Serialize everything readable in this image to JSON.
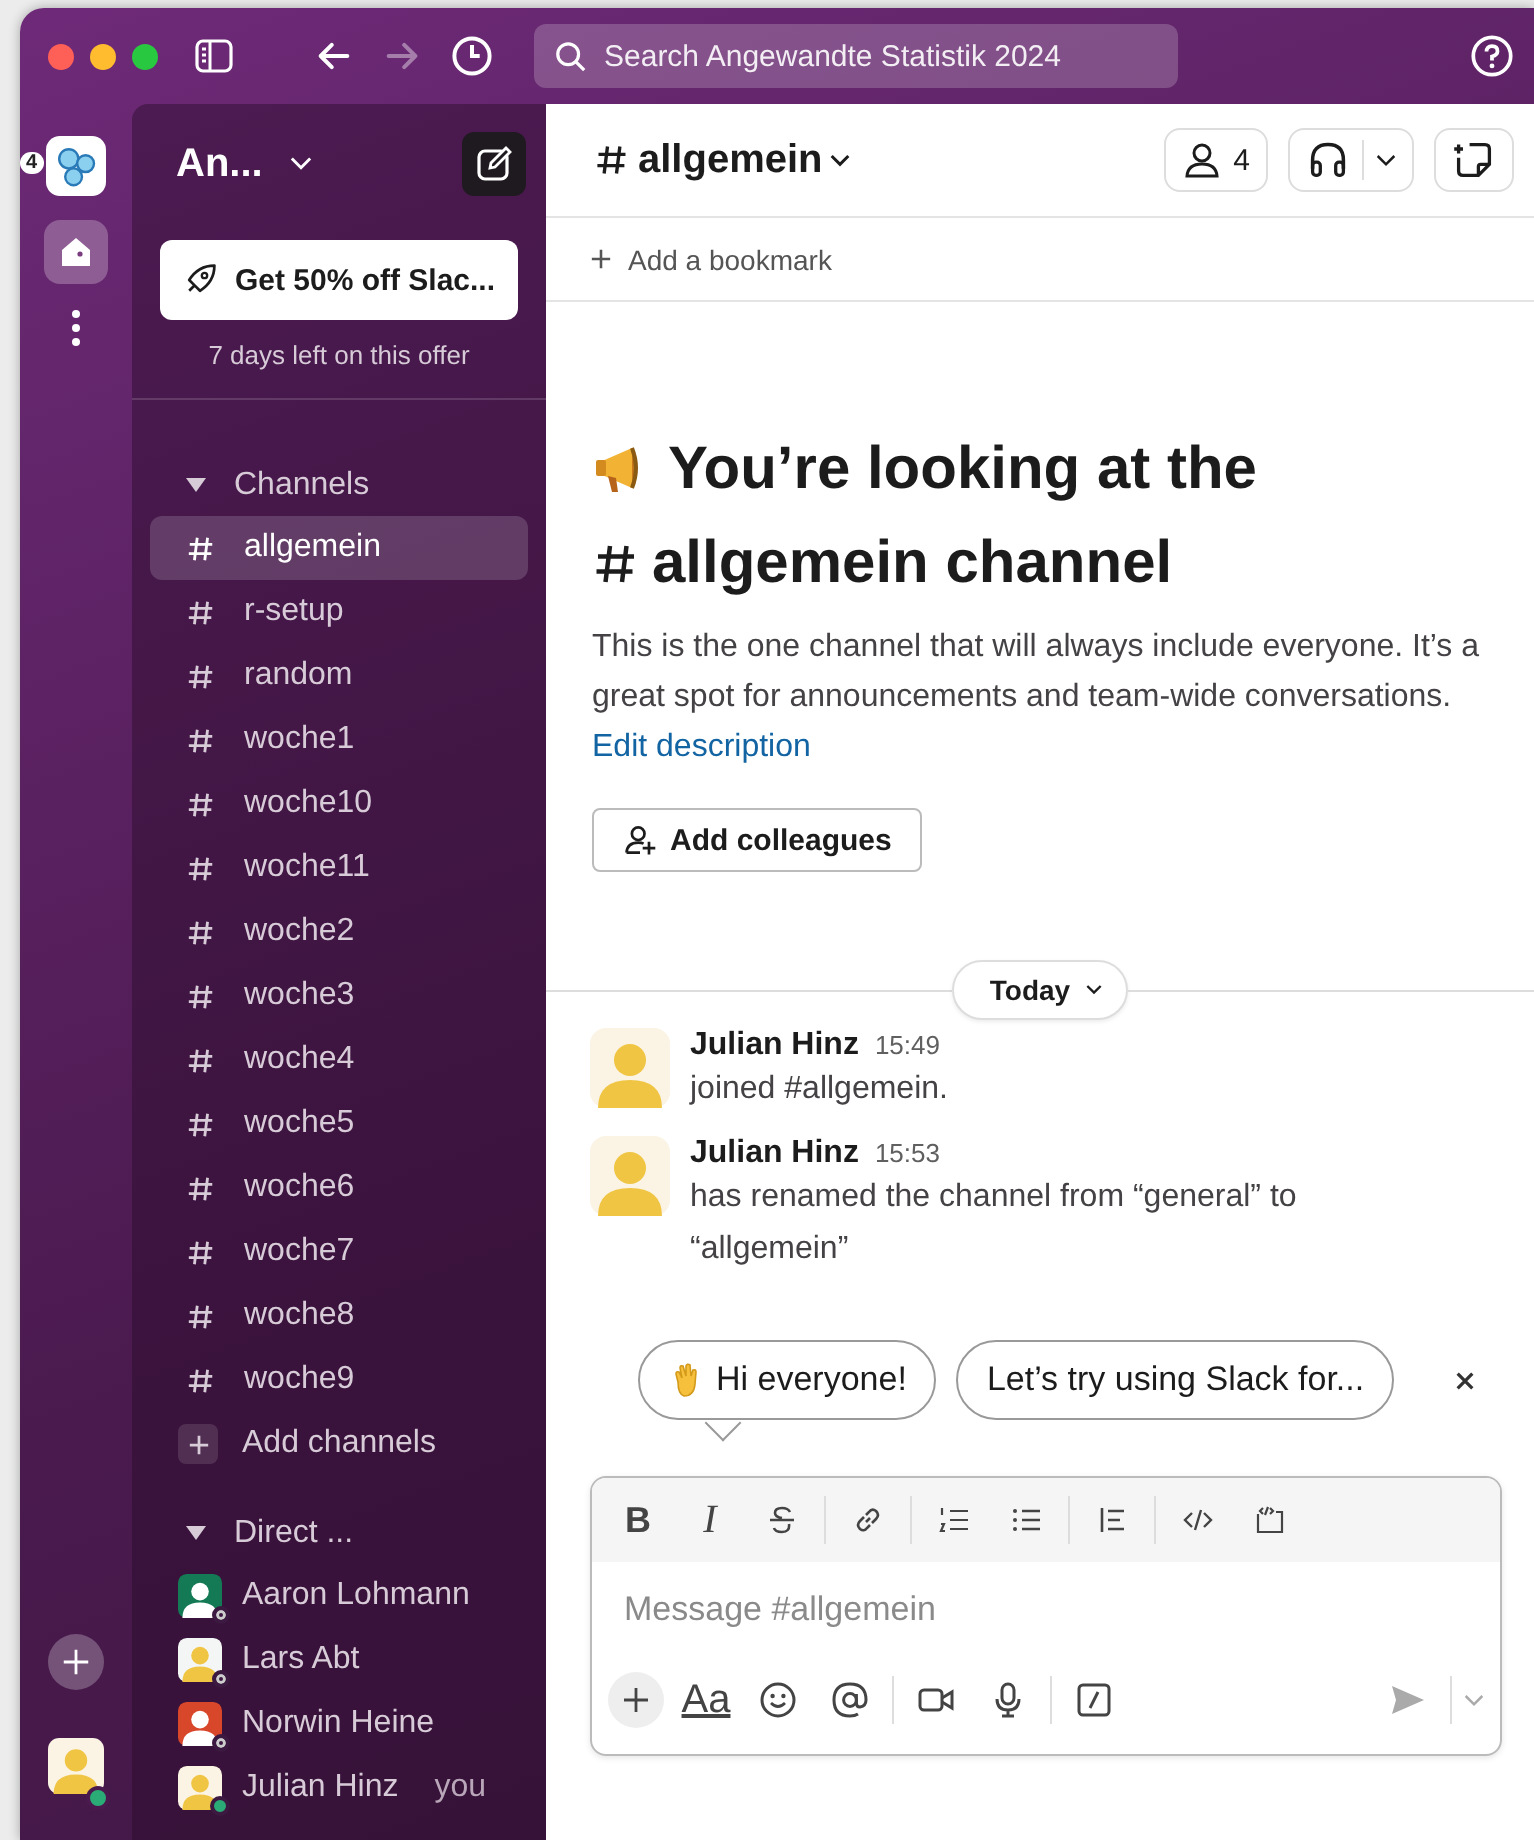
{
  "window": {
    "search_placeholder": "Search Angewandte Statistik 2024",
    "nav": [
      {
        "kind": "back",
        "disabled": false
      },
      {
        "kind": "forward",
        "disabled": true
      }
    ]
  },
  "rail": {
    "workspace_badge": "4"
  },
  "sidebar": {
    "workspace_name": "An...",
    "promo_button": "Get 50% off Slac...",
    "promo_note": "7 days left on this offer",
    "channels_heading": "Channels",
    "channels": [
      {
        "name": "allgemein",
        "selected": true
      },
      {
        "name": "r-setup",
        "selected": false
      },
      {
        "name": "random",
        "selected": false
      },
      {
        "name": "woche1",
        "selected": false
      },
      {
        "name": "woche10",
        "selected": false
      },
      {
        "name": "woche11",
        "selected": false
      },
      {
        "name": "woche2",
        "selected": false
      },
      {
        "name": "woche3",
        "selected": false
      },
      {
        "name": "woche4",
        "selected": false
      },
      {
        "name": "woche5",
        "selected": false
      },
      {
        "name": "woche6",
        "selected": false
      },
      {
        "name": "woche7",
        "selected": false
      },
      {
        "name": "woche8",
        "selected": false
      },
      {
        "name": "woche9",
        "selected": false
      }
    ],
    "add_channels": "Add channels",
    "dms_heading": "Direct ...",
    "dms": [
      {
        "name": "Aaron Lohmann",
        "color": "#137a55",
        "online": false
      },
      {
        "name": "Lars Abt",
        "color": "#f4f6f5",
        "online": false
      },
      {
        "name": "Norwin Heine",
        "color": "#d9472b",
        "online": false
      },
      {
        "name": "Julian Hinz",
        "suffix": "you",
        "color": "#fbf3e3",
        "online": true
      }
    ]
  },
  "header": {
    "channel": "allgemein",
    "member_count": "4",
    "bookmark": "Add a bookmark"
  },
  "intro": {
    "title": "You’re looking at the",
    "title_channel": "allgemein channel",
    "description": "This is the one channel that will always include everyone. It’s a great spot for announcements and team-wide conversations.",
    "link": "Edit description",
    "button": "Add colleagues"
  },
  "divider": "Today",
  "messages": [
    {
      "author": "Julian Hinz",
      "time": "15:49",
      "text": "joined #allgemein."
    },
    {
      "author": "Julian Hinz",
      "time": "15:53",
      "text": "has renamed the channel from “general” to “allgemein”"
    }
  ],
  "suggestions": [
    {
      "kind": "wave",
      "text": "Hi everyone!"
    },
    {
      "kind": "plain",
      "text": "Let’s try using Slack for..."
    }
  ],
  "composer": {
    "bold": "B",
    "italic": "I",
    "placeholder": "Message #allgemein",
    "text_format": "Aa"
  }
}
